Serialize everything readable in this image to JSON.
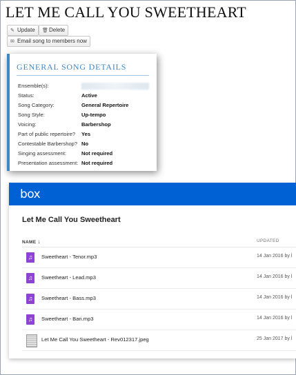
{
  "page": {
    "title": "LET ME CALL YOU SWEETHEART"
  },
  "toolbar": {
    "update_label": "Update",
    "delete_label": "Delete",
    "email_label": "Email song to members now"
  },
  "details": {
    "heading": "GENERAL SONG DETAILS",
    "rows": [
      {
        "label": "Ensemble(s):",
        "value": ""
      },
      {
        "label": "Status:",
        "value": "Active"
      },
      {
        "label": "Song Category:",
        "value": "General Repertoire"
      },
      {
        "label": "Song Style:",
        "value": "Up-tempo"
      },
      {
        "label": "Voicing:",
        "value": "Barbershop"
      },
      {
        "label": "Part of public repertoire?",
        "value": "Yes"
      },
      {
        "label": "Contestable Barbershop?",
        "value": "No"
      },
      {
        "label": "Singing assessment:",
        "value": "Not required"
      },
      {
        "label": "Presentation assessment:",
        "value": "Not required"
      }
    ]
  },
  "box": {
    "logo": "box",
    "brand_color": "#0061d5",
    "folder_title": "Let Me Call You Sweetheart",
    "columns": {
      "name": "NAME",
      "updated": "UPDATED"
    },
    "files": [
      {
        "name": "Sweetheart - Tenor.mp3",
        "updated": "14 Jan 2016 by l",
        "icon": "audio-file-icon"
      },
      {
        "name": "Sweetheart - Lead.mp3",
        "updated": "14 Jan 2016 by l",
        "icon": "audio-file-icon"
      },
      {
        "name": "Sweetheart - Bass.mp3",
        "updated": "14 Jan 2016 by l",
        "icon": "audio-file-icon"
      },
      {
        "name": "Sweetheart - Bari.mp3",
        "updated": "14 Jan 2016 by l",
        "icon": "audio-file-icon"
      },
      {
        "name": "Let Me Call You Sweetheart - Rev012317.jpeg",
        "updated": "25 Jan 2017 by l",
        "icon": "image-thumbnail-icon"
      }
    ]
  }
}
